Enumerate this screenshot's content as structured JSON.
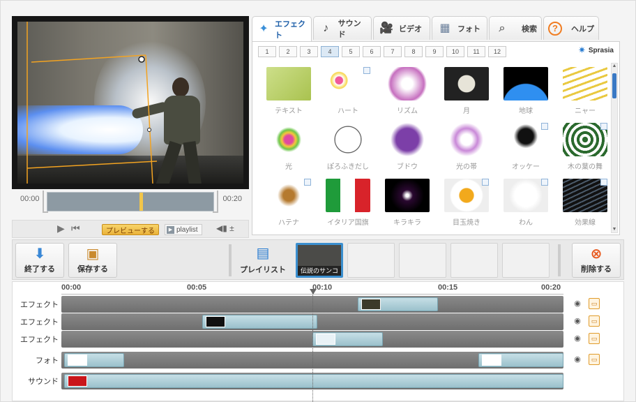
{
  "video": {
    "time_start": "00:00",
    "time_end": "00:20",
    "scrub_position": 0.55
  },
  "controls": {
    "preview_label": "プレビューする",
    "playlist_label": "playlist"
  },
  "tabs": [
    {
      "label": "エフェクト",
      "icon": "effect-icon",
      "active": true
    },
    {
      "label": "サウンド",
      "icon": "music-note-icon"
    },
    {
      "label": "ビデオ",
      "icon": "video-icon"
    },
    {
      "label": "フォト",
      "icon": "photo-icon"
    },
    {
      "label": "検索",
      "icon": "search-icon"
    },
    {
      "label": "ヘルプ",
      "icon": "help-icon"
    }
  ],
  "gallery": {
    "pages": [
      "1",
      "2",
      "3",
      "4",
      "5",
      "6",
      "7",
      "8",
      "9",
      "10",
      "11",
      "12"
    ],
    "active_page": "4",
    "brand": "Sprasia",
    "items": [
      {
        "label": "テキスト",
        "new": false
      },
      {
        "label": "ハート",
        "new": true
      },
      {
        "label": "リズム",
        "new": false
      },
      {
        "label": "月",
        "new": false
      },
      {
        "label": "地球",
        "new": false
      },
      {
        "label": "ニャー",
        "new": false
      },
      {
        "label": "光",
        "new": false
      },
      {
        "label": "ぽろふきだし",
        "new": false
      },
      {
        "label": "ブドウ",
        "new": false
      },
      {
        "label": "光の帯",
        "new": false
      },
      {
        "label": "オッケー",
        "new": true
      },
      {
        "label": "木の葉の舞",
        "new": true
      },
      {
        "label": "ハテナ",
        "new": true
      },
      {
        "label": "イタリア国旗",
        "new": false
      },
      {
        "label": "キラキラ",
        "new": false
      },
      {
        "label": "目玉焼き",
        "new": true
      },
      {
        "label": "わん",
        "new": true
      },
      {
        "label": "効果線",
        "new": true
      }
    ]
  },
  "projbar": {
    "finish_label": "終了する",
    "save_label": "保存する",
    "playlist_label": "プレイリスト",
    "slot1_caption": "伝説のサンコ",
    "delete_label": "削除する"
  },
  "timeline": {
    "ruler": [
      "00:00",
      "00:05",
      "00:10",
      "00:15",
      "00:20"
    ],
    "playhead_time": 10,
    "tracks": [
      {
        "label": "エフェクト",
        "clips": [
          {
            "start": 11.8,
            "end": 15.0,
            "thumb": "dark"
          }
        ]
      },
      {
        "label": "エフェクト",
        "clips": [
          {
            "start": 5.6,
            "end": 10.2,
            "thumb": "black"
          }
        ]
      },
      {
        "label": "エフェクト",
        "clips": [
          {
            "start": 10.0,
            "end": 12.8,
            "thumb": "light"
          }
        ]
      },
      {
        "label": "フォト",
        "clips": [
          {
            "start": 0.1,
            "end": 2.5,
            "thumb": "white"
          },
          {
            "start": 16.6,
            "end": 20.0,
            "thumb": "white"
          }
        ]
      },
      {
        "label": "サウンド",
        "clips": [
          {
            "start": 0.1,
            "end": 20.0,
            "thumb": "red"
          }
        ]
      }
    ]
  }
}
